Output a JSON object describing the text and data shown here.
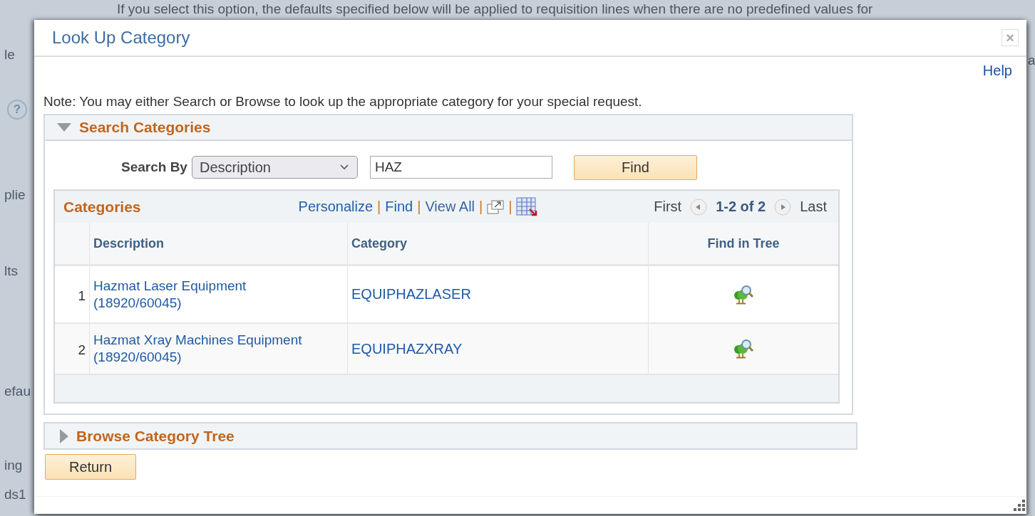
{
  "background": {
    "top_text": "If you select this option, the defaults specified below will be applied to requisition lines when there are no predefined values for",
    "help_glyph": "?",
    "left_fragments": [
      "le",
      "plie",
      "lts",
      "efau",
      "ing",
      "ds1"
    ],
    "right_fragment": "a"
  },
  "dialog": {
    "title": "Look Up Category",
    "close": "×",
    "help": "Help",
    "note": "Note: You may either Search or Browse to look up the appropriate category for your special request.",
    "search_section": {
      "title": "Search Categories",
      "expanded": true,
      "search_by_label": "Search By",
      "search_by": "Description",
      "search_value": "HAZ",
      "find_button": "Find",
      "grid": {
        "title": "Categories",
        "links": [
          "Personalize",
          "Find",
          "View All"
        ],
        "separators": [
          "|",
          "|",
          "|",
          "|"
        ],
        "first": "First",
        "range": "1-2 of 2",
        "last": "Last",
        "columns": [
          "Description",
          "Category",
          "Find in Tree"
        ],
        "rows": [
          {
            "number": "1",
            "description": [
              "Hazmat Laser Equipment",
              "(18920/60045)"
            ],
            "category": "EQUIPHAZLASER"
          },
          {
            "number": "2",
            "description": [
              "Hazmat Xray Machines Equipment",
              "(18920/60045)"
            ],
            "category": "EQUIPHAZXRAY"
          }
        ]
      }
    },
    "browse_section": {
      "title": "Browse Category Tree",
      "expanded": false
    },
    "return_button": "Return"
  }
}
